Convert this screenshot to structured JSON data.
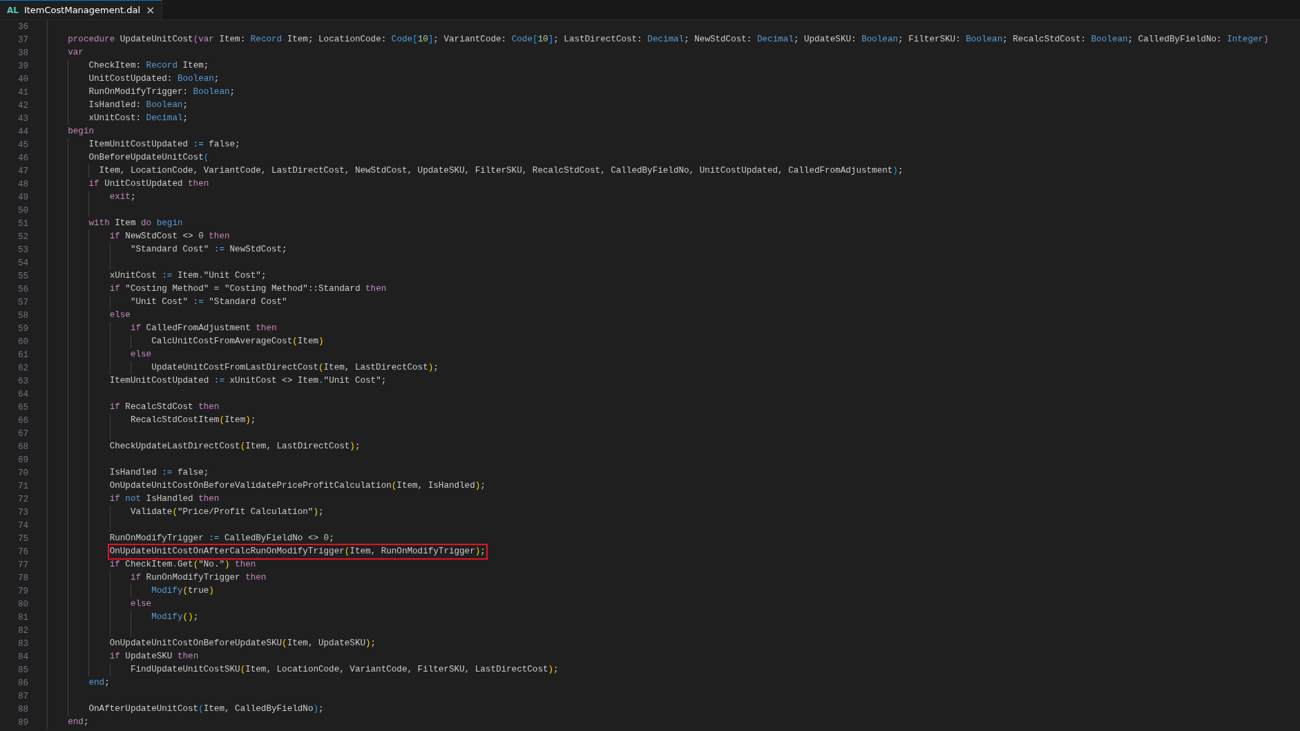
{
  "tab": {
    "icon_text": "AL",
    "label": "ItemCostManagement.dal",
    "close": "×",
    "selected": true
  },
  "lines": [
    {
      "number": "36"
    },
    {
      "number": "37",
      "code": [
        {
          "kind": "keyword",
          "text": "    procedure"
        },
        {
          "kind": "plain",
          "text": " UpdateUnitCost"
        },
        {
          "kind": "bracket2",
          "text": "("
        },
        {
          "kind": "keyword",
          "text": "var"
        },
        {
          "kind": "plain",
          "text": " Item: "
        },
        {
          "kind": "type",
          "text": "Record"
        },
        {
          "kind": "plain",
          "text": " Item; LocationCode: "
        },
        {
          "kind": "type",
          "text": "Code"
        },
        {
          "kind": "bracket3",
          "text": "["
        },
        {
          "kind": "number",
          "text": "10"
        },
        {
          "kind": "bracket3",
          "text": "]"
        },
        {
          "kind": "plain",
          "text": "; VariantCode: "
        },
        {
          "kind": "type",
          "text": "Code"
        },
        {
          "kind": "bracket3",
          "text": "["
        },
        {
          "kind": "number",
          "text": "10"
        },
        {
          "kind": "bracket3",
          "text": "]"
        },
        {
          "kind": "plain",
          "text": "; LastDirectCost: "
        },
        {
          "kind": "type",
          "text": "Decimal"
        },
        {
          "kind": "plain",
          "text": "; NewStdCost: "
        },
        {
          "kind": "type",
          "text": "Decimal"
        },
        {
          "kind": "plain",
          "text": "; UpdateSKU: "
        },
        {
          "kind": "type",
          "text": "Boolean"
        },
        {
          "kind": "plain",
          "text": "; FilterSKU: "
        },
        {
          "kind": "type",
          "text": "Boolean"
        },
        {
          "kind": "plain",
          "text": "; RecalcStdCost: "
        },
        {
          "kind": "type",
          "text": "Boolean"
        },
        {
          "kind": "plain",
          "text": "; CalledByFieldNo: "
        },
        {
          "kind": "type",
          "text": "Integer"
        },
        {
          "kind": "bracket2",
          "text": ")"
        }
      ]
    },
    {
      "number": "38",
      "code": [
        {
          "kind": "keyword",
          "text": "    var"
        }
      ]
    },
    {
      "number": "39",
      "code": [
        {
          "kind": "plain",
          "text": "        CheckItem: "
        },
        {
          "kind": "type",
          "text": "Record"
        },
        {
          "kind": "plain",
          "text": " Item;"
        }
      ]
    },
    {
      "number": "40",
      "code": [
        {
          "kind": "plain",
          "text": "        UnitCostUpdated: "
        },
        {
          "kind": "type",
          "text": "Boolean"
        },
        {
          "kind": "plain",
          "text": ";"
        }
      ]
    },
    {
      "number": "41",
      "code": [
        {
          "kind": "plain",
          "text": "        RunOnModifyTrigger: "
        },
        {
          "kind": "type",
          "text": "Boolean"
        },
        {
          "kind": "plain",
          "text": ";"
        }
      ]
    },
    {
      "number": "42",
      "code": [
        {
          "kind": "plain",
          "text": "        IsHandled: "
        },
        {
          "kind": "type",
          "text": "Boolean"
        },
        {
          "kind": "plain",
          "text": ";"
        }
      ]
    },
    {
      "number": "43",
      "code": [
        {
          "kind": "plain",
          "text": "        xUnitCost: "
        },
        {
          "kind": "type",
          "text": "Decimal"
        },
        {
          "kind": "plain",
          "text": ";"
        }
      ]
    },
    {
      "number": "44",
      "code": [
        {
          "kind": "keyword",
          "text": "    begin"
        }
      ]
    },
    {
      "number": "45",
      "code": [
        {
          "kind": "plain",
          "text": "        ItemUnitCostUpdated "
        },
        {
          "kind": "operator",
          "text": ":="
        },
        {
          "kind": "plain",
          "text": " false;"
        }
      ]
    },
    {
      "number": "46",
      "code": [
        {
          "kind": "plain",
          "text": "        OnBeforeUpdateUnitCost"
        },
        {
          "kind": "bracket3",
          "text": "("
        }
      ]
    },
    {
      "number": "47",
      "code": [
        {
          "kind": "plain",
          "text": "          Item, LocationCode, VariantCode, LastDirectCost, NewStdCost, UpdateSKU, FilterSKU, RecalcStdCost, CalledByFieldNo, UnitCostUpdated, CalledFromAdjustment"
        },
        {
          "kind": "bracket3",
          "text": ")"
        },
        {
          "kind": "plain",
          "text": ";"
        }
      ]
    },
    {
      "number": "48",
      "code": [
        {
          "kind": "keyword",
          "text": "        if"
        },
        {
          "kind": "plain",
          "text": " UnitCostUpdated "
        },
        {
          "kind": "keyword",
          "text": "then"
        }
      ]
    },
    {
      "number": "49",
      "code": [
        {
          "kind": "keyword",
          "text": "            exit"
        },
        {
          "kind": "plain",
          "text": ";"
        }
      ]
    },
    {
      "number": "50"
    },
    {
      "number": "51",
      "code": [
        {
          "kind": "keyword",
          "text": "        with"
        },
        {
          "kind": "plain",
          "text": " Item "
        },
        {
          "kind": "keyword",
          "text": "do"
        },
        {
          "kind": "type",
          "text": " begin"
        }
      ]
    },
    {
      "number": "52",
      "code": [
        {
          "kind": "keyword",
          "text": "            if"
        },
        {
          "kind": "plain",
          "text": " NewStdCost <> "
        },
        {
          "kind": "number",
          "text": "0"
        },
        {
          "kind": "keyword",
          "text": " then"
        }
      ]
    },
    {
      "number": "53",
      "code": [
        {
          "kind": "plain",
          "text": "                \"Standard Cost\" "
        },
        {
          "kind": "operator",
          "text": ":="
        },
        {
          "kind": "plain",
          "text": " NewStdCost;"
        }
      ]
    },
    {
      "number": "54"
    },
    {
      "number": "55",
      "code": [
        {
          "kind": "plain",
          "text": "            xUnitCost "
        },
        {
          "kind": "operator",
          "text": ":="
        },
        {
          "kind": "plain",
          "text": " Item"
        },
        {
          "kind": "operator",
          "text": "."
        },
        {
          "kind": "plain",
          "text": "\"Unit Cost\";"
        }
      ]
    },
    {
      "number": "56",
      "code": [
        {
          "kind": "keyword",
          "text": "            if"
        },
        {
          "kind": "plain",
          "text": " \"Costing Method\" = \"Costing Method\"::Standard "
        },
        {
          "kind": "keyword",
          "text": "then"
        }
      ]
    },
    {
      "number": "57",
      "code": [
        {
          "kind": "plain",
          "text": "                \"Unit Cost\" "
        },
        {
          "kind": "operator",
          "text": ":="
        },
        {
          "kind": "plain",
          "text": " \"Standard Cost\""
        }
      ]
    },
    {
      "number": "58",
      "code": [
        {
          "kind": "keyword",
          "text": "            else"
        }
      ]
    },
    {
      "number": "59",
      "code": [
        {
          "kind": "keyword",
          "text": "                if"
        },
        {
          "kind": "plain",
          "text": " CalledFromAdjustment "
        },
        {
          "kind": "keyword",
          "text": "then"
        }
      ]
    },
    {
      "number": "60",
      "code": [
        {
          "kind": "plain",
          "text": "                    CalcUnitCostFromAverageCost"
        },
        {
          "kind": "bracket1",
          "text": "("
        },
        {
          "kind": "plain",
          "text": "Item"
        },
        {
          "kind": "bracket1",
          "text": ")"
        }
      ]
    },
    {
      "number": "61",
      "code": [
        {
          "kind": "keyword",
          "text": "                else"
        }
      ]
    },
    {
      "number": "62",
      "code": [
        {
          "kind": "plain",
          "text": "                    UpdateUnitCostFromLastDirectCost"
        },
        {
          "kind": "bracket1",
          "text": "("
        },
        {
          "kind": "plain",
          "text": "Item, LastDirectCost"
        },
        {
          "kind": "bracket1",
          "text": ")"
        },
        {
          "kind": "plain",
          "text": ";"
        }
      ]
    },
    {
      "number": "63",
      "code": [
        {
          "kind": "plain",
          "text": "            ItemUnitCostUpdated "
        },
        {
          "kind": "operator",
          "text": ":="
        },
        {
          "kind": "plain",
          "text": " xUnitCost <> Item"
        },
        {
          "kind": "operator",
          "text": "."
        },
        {
          "kind": "plain",
          "text": "\"Unit Cost\";"
        }
      ]
    },
    {
      "number": "64"
    },
    {
      "number": "65",
      "code": [
        {
          "kind": "keyword",
          "text": "            if"
        },
        {
          "kind": "plain",
          "text": " RecalcStdCost "
        },
        {
          "kind": "keyword",
          "text": "then"
        }
      ]
    },
    {
      "number": "66",
      "code": [
        {
          "kind": "plain",
          "text": "                RecalcStdCostItem"
        },
        {
          "kind": "bracket1",
          "text": "("
        },
        {
          "kind": "plain",
          "text": "Item"
        },
        {
          "kind": "bracket1",
          "text": ")"
        },
        {
          "kind": "plain",
          "text": ";"
        }
      ]
    },
    {
      "number": "67"
    },
    {
      "number": "68",
      "code": [
        {
          "kind": "plain",
          "text": "            CheckUpdateLastDirectCost"
        },
        {
          "kind": "bracket1",
          "text": "("
        },
        {
          "kind": "plain",
          "text": "Item, LastDirectCost"
        },
        {
          "kind": "bracket1",
          "text": ")"
        },
        {
          "kind": "plain",
          "text": ";"
        }
      ]
    },
    {
      "number": "69"
    },
    {
      "number": "70",
      "code": [
        {
          "kind": "plain",
          "text": "            IsHandled "
        },
        {
          "kind": "operator",
          "text": ":="
        },
        {
          "kind": "plain",
          "text": " false;"
        }
      ]
    },
    {
      "number": "71",
      "code": [
        {
          "kind": "plain",
          "text": "            OnUpdateUnitCostOnBeforeValidatePriceProfitCalculation"
        },
        {
          "kind": "bracket1",
          "text": "("
        },
        {
          "kind": "plain",
          "text": "Item, IsHandled"
        },
        {
          "kind": "bracket1",
          "text": ")"
        },
        {
          "kind": "plain",
          "text": ";"
        }
      ]
    },
    {
      "number": "72",
      "code": [
        {
          "kind": "keyword",
          "text": "            if"
        },
        {
          "kind": "type",
          "text": " not"
        },
        {
          "kind": "plain",
          "text": " IsHandled "
        },
        {
          "kind": "keyword",
          "text": "then"
        }
      ]
    },
    {
      "number": "73",
      "code": [
        {
          "kind": "plain",
          "text": "                Validate"
        },
        {
          "kind": "bracket1",
          "text": "("
        },
        {
          "kind": "plain",
          "text": "\"Price/Profit Calculation\""
        },
        {
          "kind": "bracket1",
          "text": ")"
        },
        {
          "kind": "plain",
          "text": ";"
        }
      ]
    },
    {
      "number": "74"
    },
    {
      "number": "75",
      "code": [
        {
          "kind": "plain",
          "text": "            RunOnModifyTrigger "
        },
        {
          "kind": "operator",
          "text": ":="
        },
        {
          "kind": "plain",
          "text": " CalledByFieldNo <> "
        },
        {
          "kind": "number",
          "text": "0"
        },
        {
          "kind": "plain",
          "text": ";"
        }
      ]
    },
    {
      "number": "76",
      "highlighted": true,
      "code": [
        {
          "kind": "plain",
          "text": "            OnUpdateUnitCostOnAfterCalcRunOnModifyTrigger"
        },
        {
          "kind": "bracket1",
          "text": "("
        },
        {
          "kind": "plain",
          "text": "Item, RunOnModifyTrigger"
        },
        {
          "kind": "bracket1",
          "text": ")"
        },
        {
          "kind": "plain",
          "text": ";"
        }
      ]
    },
    {
      "number": "77",
      "code": [
        {
          "kind": "keyword",
          "text": "            if"
        },
        {
          "kind": "plain",
          "text": " CheckItem"
        },
        {
          "kind": "operator",
          "text": "."
        },
        {
          "kind": "plain",
          "text": "Get"
        },
        {
          "kind": "bracket1",
          "text": "("
        },
        {
          "kind": "plain",
          "text": "\"No.\""
        },
        {
          "kind": "bracket1",
          "text": ")"
        },
        {
          "kind": "keyword",
          "text": " then"
        }
      ]
    },
    {
      "number": "78",
      "code": [
        {
          "kind": "keyword",
          "text": "                if"
        },
        {
          "kind": "plain",
          "text": " RunOnModifyTrigger "
        },
        {
          "kind": "keyword",
          "text": "then"
        }
      ]
    },
    {
      "number": "79",
      "code": [
        {
          "kind": "type",
          "text": "                    Modify"
        },
        {
          "kind": "bracket1",
          "text": "("
        },
        {
          "kind": "plain",
          "text": "true"
        },
        {
          "kind": "bracket1",
          "text": ")"
        }
      ]
    },
    {
      "number": "80",
      "code": [
        {
          "kind": "keyword",
          "text": "                else"
        }
      ]
    },
    {
      "number": "81",
      "code": [
        {
          "kind": "type",
          "text": "                    Modify"
        },
        {
          "kind": "bracket1",
          "text": "()"
        },
        {
          "kind": "plain",
          "text": ";"
        }
      ]
    },
    {
      "number": "82"
    },
    {
      "number": "83",
      "code": [
        {
          "kind": "plain",
          "text": "            OnUpdateUnitCostOnBeforeUpdateSKU"
        },
        {
          "kind": "bracket1",
          "text": "("
        },
        {
          "kind": "plain",
          "text": "Item, UpdateSKU"
        },
        {
          "kind": "bracket1",
          "text": ")"
        },
        {
          "kind": "plain",
          "text": ";"
        }
      ]
    },
    {
      "number": "84",
      "code": [
        {
          "kind": "keyword",
          "text": "            if"
        },
        {
          "kind": "plain",
          "text": " UpdateSKU "
        },
        {
          "kind": "keyword",
          "text": "then"
        }
      ]
    },
    {
      "number": "85",
      "code": [
        {
          "kind": "plain",
          "text": "                FindUpdateUnitCostSKU"
        },
        {
          "kind": "bracket1",
          "text": "("
        },
        {
          "kind": "plain",
          "text": "Item, LocationCode, VariantCode, FilterSKU, LastDirectCost"
        },
        {
          "kind": "bracket1",
          "text": ")"
        },
        {
          "kind": "plain",
          "text": ";"
        }
      ]
    },
    {
      "number": "86",
      "code": [
        {
          "kind": "type",
          "text": "        end"
        },
        {
          "kind": "plain",
          "text": ";"
        }
      ]
    },
    {
      "number": "87"
    },
    {
      "number": "88",
      "code": [
        {
          "kind": "plain",
          "text": "        OnAfterUpdateUnitCost"
        },
        {
          "kind": "bracket3",
          "text": "("
        },
        {
          "kind": "plain",
          "text": "Item, CalledByFieldNo"
        },
        {
          "kind": "bracket3",
          "text": ")"
        },
        {
          "kind": "plain",
          "text": ";"
        }
      ]
    },
    {
      "number": "89",
      "code": [
        {
          "kind": "keyword",
          "text": "    end"
        },
        {
          "kind": "plain",
          "text": ";"
        }
      ]
    }
  ]
}
